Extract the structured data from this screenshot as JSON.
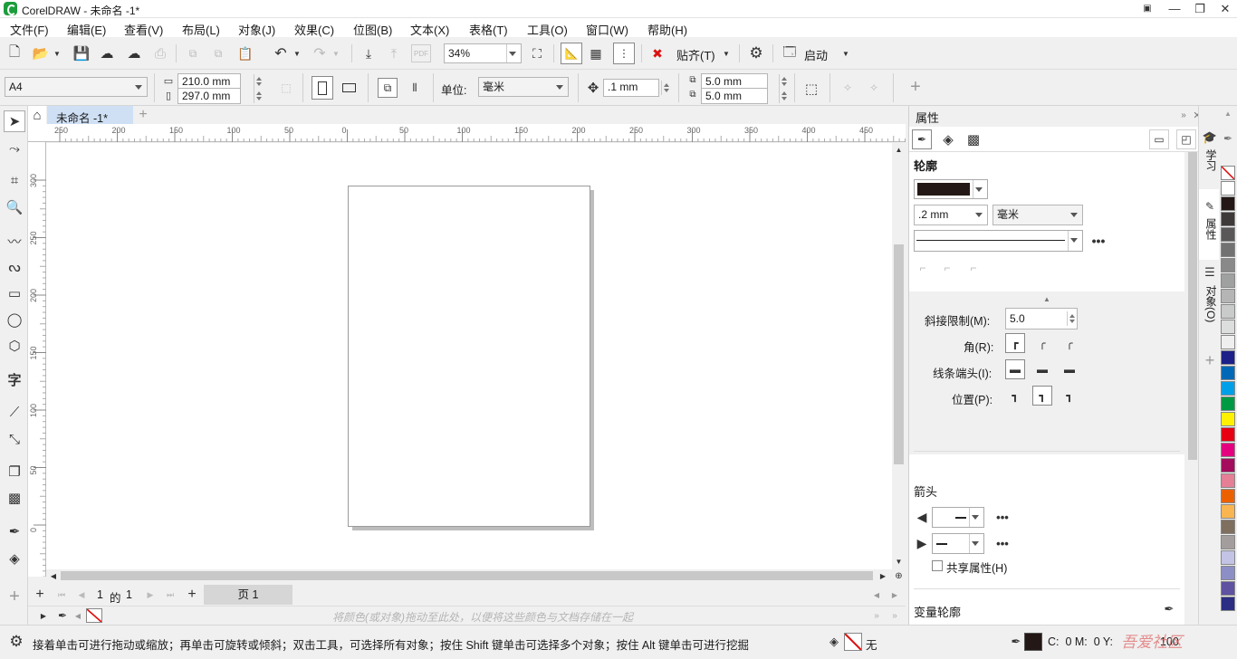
{
  "window": {
    "title": "CorelDRAW - 未命名 -1*"
  },
  "menu": [
    "文件(F)",
    "编辑(E)",
    "查看(V)",
    "布局(L)",
    "对象(J)",
    "效果(C)",
    "位图(B)",
    "文本(X)",
    "表格(T)",
    "工具(O)",
    "窗口(W)",
    "帮助(H)"
  ],
  "toolbar": {
    "zoom": "34%",
    "snap_label": "贴齐(T)",
    "launch_label": "启动"
  },
  "propbar": {
    "paper_size": "A4",
    "width": "210.0 mm",
    "height": "297.0 mm",
    "unit_label": "单位:",
    "unit_value": "毫米",
    "nudge": ".1 mm",
    "dup_x": "5.0 mm",
    "dup_y": "5.0 mm"
  },
  "tab": {
    "home": "home",
    "doc": "未命名 -1*"
  },
  "ruler_h": [
    "250",
    "200",
    "150",
    "100",
    "50",
    "0",
    "50",
    "100",
    "150",
    "200",
    "250",
    "300",
    "350",
    "400",
    "450"
  ],
  "ruler_v": [
    "300",
    "250",
    "200",
    "150",
    "100",
    "50",
    "0"
  ],
  "pagenav": {
    "current": "1",
    "of": "的",
    "total": "1",
    "page_tab": "页 1"
  },
  "palette_hint": "将颜色(或对象)拖动至此处，以便将这些颜色与文档存储在一起",
  "docker": {
    "title": "属性",
    "outline_heading": "轮廓",
    "outline_width": ".2 mm",
    "outline_unit": "毫米",
    "miter_label": "斜接限制(M):",
    "miter_value": "5.0",
    "corner_label": "角(R):",
    "linecap_label": "线条端头(I):",
    "position_label": "位置(P):",
    "arrows_heading": "箭头",
    "share_label": "共享属性(H)",
    "variable_heading": "变量轮廓",
    "side_tabs": [
      "学习",
      "属性",
      "对象(O)"
    ]
  },
  "status": {
    "hint": "接着单击可进行拖动或缩放；再单击可旋转或倾斜；双击工具，可选择所有对象；按住 Shift 键单击可选择多个对象；按住 Alt 键单击可进行挖掘",
    "fill_none": "无",
    "cmyk": "C:  0 M:  0 Y:",
    "value": "100"
  },
  "colors": {
    "accent": "#1c9d3c",
    "outline_color": "#231815",
    "palette": [
      "#ffffff",
      "#231815",
      "#3e3a39",
      "#595757",
      "#727171",
      "#898989",
      "#9fa0a0",
      "#b5b5b6",
      "#c9caca",
      "#dcdddd",
      "#efefef",
      "#1d2088",
      "#0068b7",
      "#00a0e9",
      "#009944",
      "#fff100",
      "#e60012",
      "#e4007f",
      "#a40b5d",
      "#e47f95",
      "#eb6100",
      "#f8b551",
      "#7f6f5f",
      "#a39e9d",
      "#c2c3e5",
      "#8c8fc6",
      "#5f52a0",
      "#2b2e83"
    ]
  },
  "watermark": "吾爱社区"
}
